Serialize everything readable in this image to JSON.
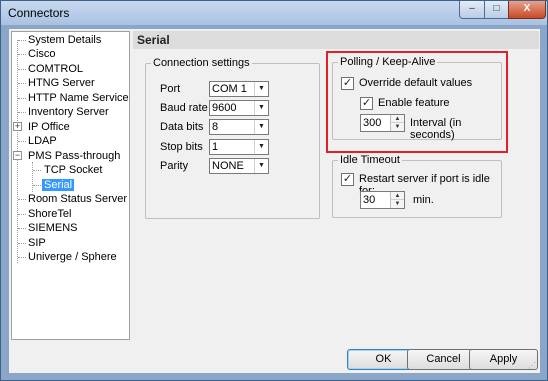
{
  "window": {
    "title": "Connectors",
    "minimize_icon": "minimize-icon",
    "maximize_icon": "maximize-icon",
    "close_icon": "close-icon",
    "minimize_glyph": "–",
    "maximize_glyph": "□",
    "close_glyph": "X"
  },
  "tree": {
    "items": [
      {
        "label": "System Details"
      },
      {
        "label": "Cisco"
      },
      {
        "label": "COMTROL"
      },
      {
        "label": "HTNG Server"
      },
      {
        "label": "HTTP Name Service"
      },
      {
        "label": "Inventory Server"
      },
      {
        "label": "IP Office",
        "expander": "+"
      },
      {
        "label": "LDAP"
      },
      {
        "label": "PMS Pass-through",
        "expander": "−"
      },
      {
        "label": "TCP Socket"
      },
      {
        "label": "Serial",
        "selected": true
      },
      {
        "label": "Room Status Server"
      },
      {
        "label": "ShoreTel"
      },
      {
        "label": "SIEMENS"
      },
      {
        "label": "SIP"
      },
      {
        "label": "Univerge / Sphere"
      }
    ]
  },
  "section": {
    "title": "Serial"
  },
  "connection_settings": {
    "legend": "Connection settings",
    "port_label": "Port",
    "port_value": "COM 1",
    "baud_label": "Baud rate",
    "baud_value": "9600",
    "data_bits_label": "Data bits",
    "data_bits_value": "8",
    "stop_bits_label": "Stop bits",
    "stop_bits_value": "1",
    "parity_label": "Parity",
    "parity_value": "NONE"
  },
  "polling": {
    "legend": "Polling / Keep-Alive",
    "override_label": "Override default values",
    "override_checked": true,
    "enable_label": "Enable feature",
    "enable_checked": true,
    "interval_value": "300",
    "interval_label": "Interval (in seconds)",
    "highlight_color": "#e0202a"
  },
  "idle_timeout": {
    "legend": "Idle Timeout",
    "restart_label": "Restart server if port is idle for:",
    "restart_checked": true,
    "minutes_value": "30",
    "minutes_label": "min."
  },
  "buttons": {
    "ok": "OK",
    "cancel": "Cancel",
    "apply": "Apply"
  },
  "glyphs": {
    "check": "✓",
    "dropdown": "▼",
    "spin_up": "▲",
    "spin_down": "▼"
  }
}
